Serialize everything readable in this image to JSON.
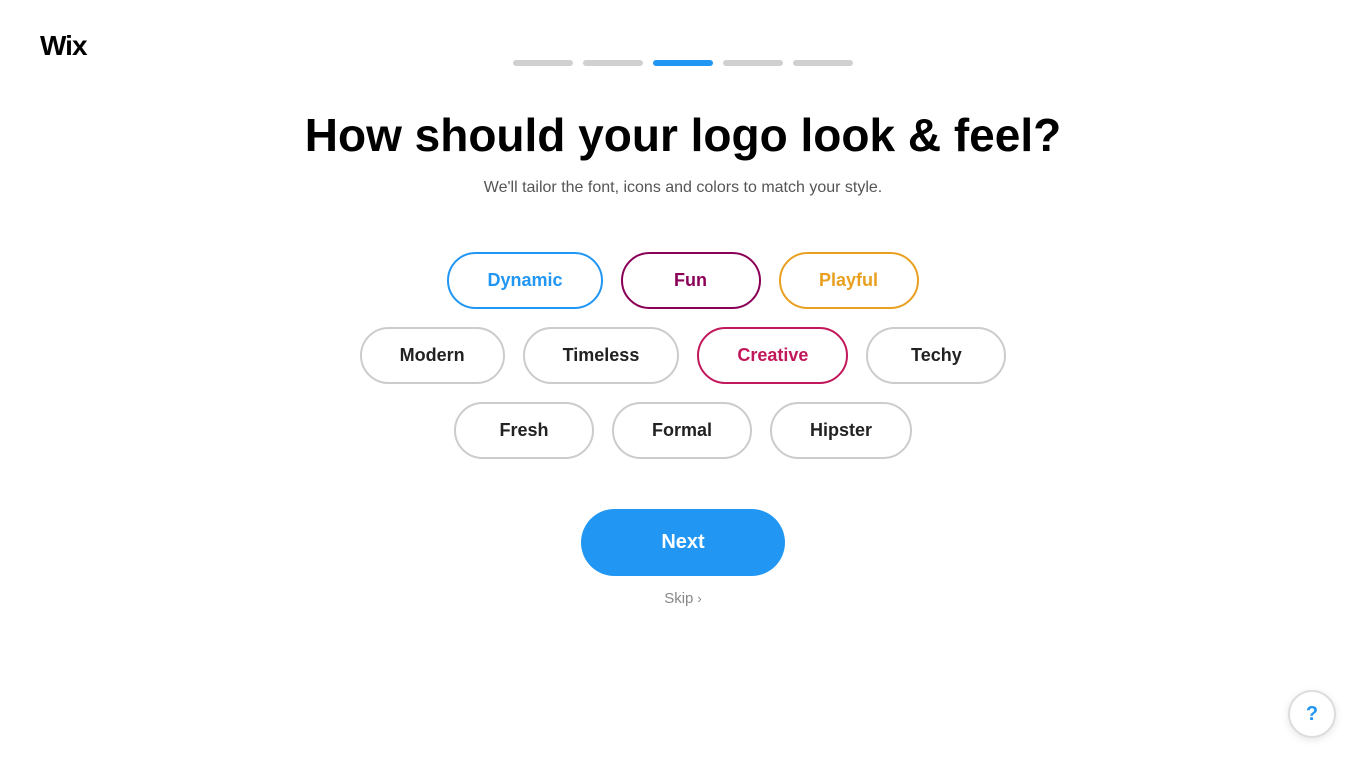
{
  "logo": {
    "text": "Wix"
  },
  "progress": {
    "segments": [
      {
        "id": 1,
        "active": false
      },
      {
        "id": 2,
        "active": false
      },
      {
        "id": 3,
        "active": true
      },
      {
        "id": 4,
        "active": false
      },
      {
        "id": 5,
        "active": false
      }
    ]
  },
  "page": {
    "title": "How should your logo look & feel?",
    "subtitle": "We'll tailor the font, icons and colors to match your style."
  },
  "style_options": {
    "row1": [
      {
        "id": "dynamic",
        "label": "Dynamic",
        "state": "selected-blue"
      },
      {
        "id": "fun",
        "label": "Fun",
        "state": "selected-purple"
      },
      {
        "id": "playful",
        "label": "Playful",
        "state": "selected-orange"
      }
    ],
    "row2": [
      {
        "id": "modern",
        "label": "Modern",
        "state": "unselected"
      },
      {
        "id": "timeless",
        "label": "Timeless",
        "state": "unselected"
      },
      {
        "id": "creative",
        "label": "Creative",
        "state": "selected-pink"
      },
      {
        "id": "techy",
        "label": "Techy",
        "state": "unselected"
      }
    ],
    "row3": [
      {
        "id": "fresh",
        "label": "Fresh",
        "state": "unselected"
      },
      {
        "id": "formal",
        "label": "Formal",
        "state": "unselected"
      },
      {
        "id": "hipster",
        "label": "Hipster",
        "state": "unselected"
      }
    ]
  },
  "actions": {
    "next_label": "Next",
    "skip_label": "Skip",
    "skip_chevron": "›"
  },
  "help": {
    "label": "?"
  }
}
